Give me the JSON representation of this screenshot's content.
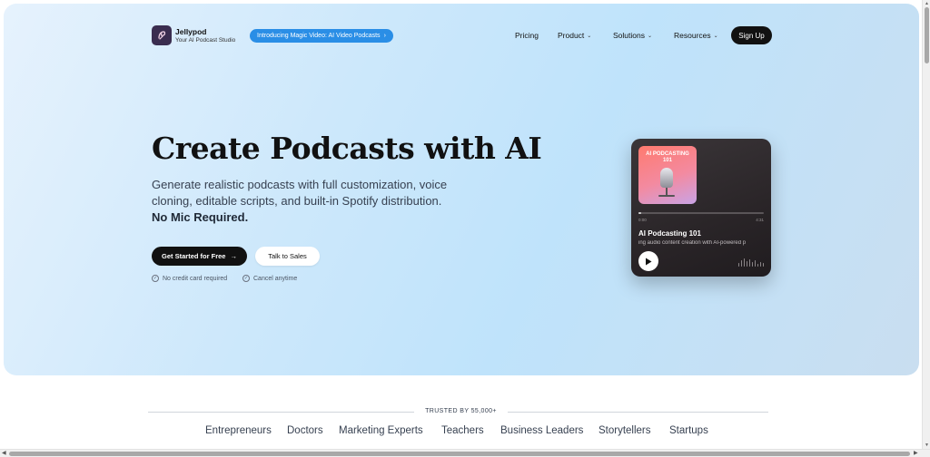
{
  "nav": {
    "brand_name": "Jellypod",
    "brand_tagline": "Your AI Podcast Studio",
    "promo_label": "Introducing Magic Video: AI Video Podcasts",
    "promo_arrow": "›",
    "pricing": "Pricing",
    "product": "Product",
    "solutions": "Solutions",
    "resources": "Resources",
    "chevron": "⌄",
    "sign_up": "Sign Up"
  },
  "hero": {
    "title": "Create Podcasts with AI",
    "description": "Generate realistic podcasts with full customization, voice cloning, editable scripts, and built-in Spotify distribution.",
    "highlight": "No Mic Required.",
    "primary_cta": "Get Started for Free",
    "primary_cta_arrow": "→",
    "secondary_cta": "Talk to Sales",
    "note_1": "No credit card required",
    "note_2": "Cancel anytime",
    "check": "✓"
  },
  "player": {
    "cover_title": "AI PODCASTING",
    "cover_number": "101",
    "time_elapsed": "0:00",
    "time_total": "4:31",
    "progress": 0.02,
    "episode_title": "AI Podcasting 101",
    "episode_subtitle": "ing audio content creation with AI-powered p",
    "waveform": [
      4,
      7,
      9,
      6,
      8,
      5,
      7,
      3,
      5,
      4
    ]
  },
  "trusted": {
    "label": "TRUSTED BY 55,000+",
    "audiences": [
      "Entrepreneurs",
      "Doctors",
      "Marketing Experts",
      "Teachers",
      "Business Leaders",
      "Storytellers",
      "Startups"
    ]
  },
  "scroll": {
    "up": "▲",
    "down": "▼",
    "left": "◀",
    "right": "▶"
  },
  "colors": {
    "promo": "#2a8ee6",
    "dark": "#111111",
    "card": "#2a2528"
  },
  "icons": [
    "jellypod-logo-icon",
    "chevron-down-icon",
    "arrow-right-icon",
    "check-circle-icon",
    "microphone-icon",
    "play-icon",
    "waveform-icon"
  ]
}
